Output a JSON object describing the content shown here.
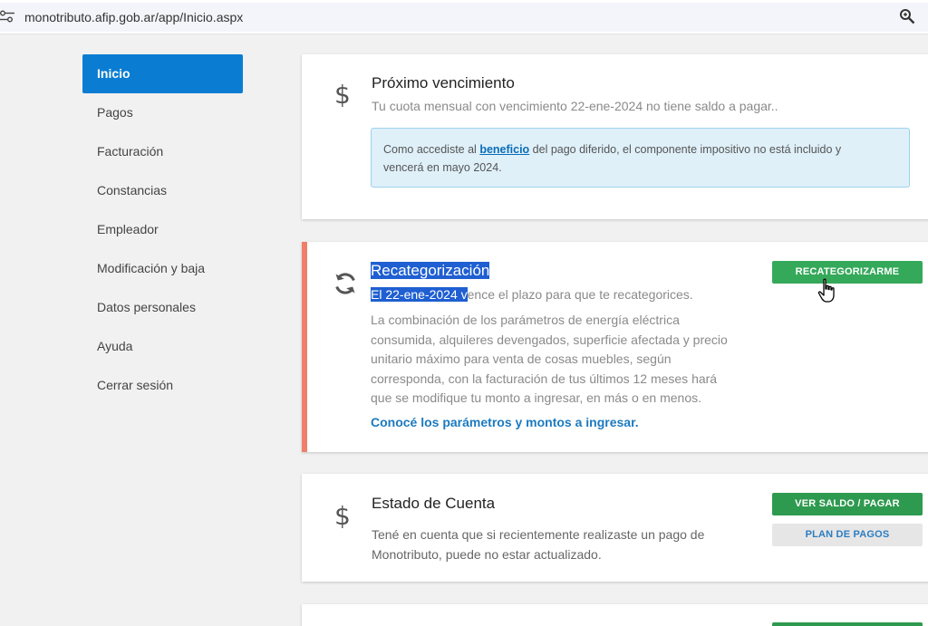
{
  "browser": {
    "url": "monotributo.afip.gob.ar/app/Inicio.aspx",
    "site_settings_icon": "tune-icon",
    "zoom_icon": "magnifier-icon"
  },
  "sidebar": {
    "items": [
      {
        "label": "Inicio",
        "active": true
      },
      {
        "label": "Pagos"
      },
      {
        "label": "Facturación"
      },
      {
        "label": "Constancias"
      },
      {
        "label": "Empleador"
      },
      {
        "label": "Modificación y baja"
      },
      {
        "label": "Datos personales"
      },
      {
        "label": "Ayuda"
      },
      {
        "label": "Cerrar sesión"
      }
    ],
    "active_color": "#0a7dd2"
  },
  "proximo": {
    "icon": "$",
    "title": "Próximo vencimiento",
    "subtitle": "Tu cuota mensual con vencimiento 22-ene-2024 no tiene saldo a pagar..",
    "info_before": "Como accediste al ",
    "info_link": "beneficio",
    "info_line1_after": " del pago diferido, el componente impositivo no está incluido y",
    "info_line2": "vencerá en mayo 2024."
  },
  "recategorizacion": {
    "icon": "refresh-icon",
    "title": "Recategorización",
    "sub_selected": "El 22-ene-2024 v",
    "sub_rest": "ence el plazo para que te recategorices.",
    "body_lines": [
      "La combinación de los parámetros de energía eléctrica",
      "consumida, alquileres devengados, superficie afectada y precio",
      "unitario máximo para venta de cosas muebles, según",
      "corresponda, con la facturación de tus últimos 12 meses hará",
      "que se modifique tu monto a ingresar, en más o en menos."
    ],
    "link": "Conocé los parámetros y montos a ingresar.",
    "button": "RECATEGORIZARME",
    "accent_color": "#ef7f6a"
  },
  "estado": {
    "icon": "$",
    "title": "Estado de Cuenta",
    "body_lines": [
      "Tené en cuenta que si recientemente realizaste un pago de",
      "Monotributo, puede no estar actualizado."
    ],
    "button_primary": "VER SALDO / PAGAR",
    "button_secondary": "PLAN DE PAGOS"
  }
}
